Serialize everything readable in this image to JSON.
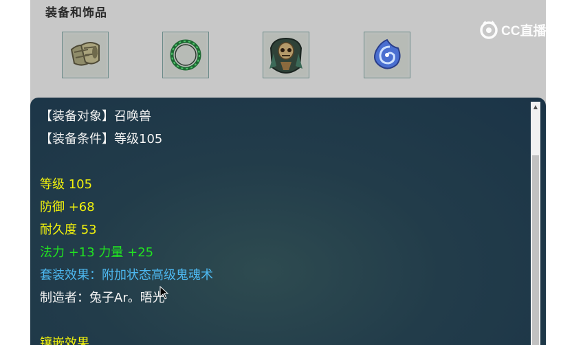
{
  "section": {
    "title": "装备和饰品"
  },
  "slots": [
    {
      "icon": "armor-bracer-icon"
    },
    {
      "icon": "thorn-ring-icon"
    },
    {
      "icon": "skull-armor-icon"
    },
    {
      "icon": "blue-spiral-orb-icon"
    }
  ],
  "tooltip": {
    "lines": [
      {
        "text": "【装备对象】召唤兽",
        "color": "white"
      },
      {
        "text": "【装备条件】等级105",
        "color": "white"
      },
      {
        "text": "",
        "color": "white"
      },
      {
        "text": "等级 105",
        "color": "yellow"
      },
      {
        "text": "防御 +68",
        "color": "yellow"
      },
      {
        "text": "耐久度 53",
        "color": "yellow"
      },
      {
        "text": "法力 +13 力量 +25",
        "color": "green"
      },
      {
        "text": "套装效果：附加状态高级鬼魂术",
        "color": "blue"
      },
      {
        "text": "制造者：兔子Ar。晤光",
        "color": "white"
      },
      {
        "text": "",
        "color": "white"
      },
      {
        "text": "镶嵌效果",
        "color": "yellow"
      }
    ]
  },
  "watermark": {
    "text": "CC直播"
  },
  "colors": {
    "white": "#f2f2f2",
    "yellow": "#f2f20c",
    "green": "#21e321",
    "blue": "#4db8f0",
    "panel": "#c8c8c8",
    "tooltip_bg": "#1f3a48"
  }
}
